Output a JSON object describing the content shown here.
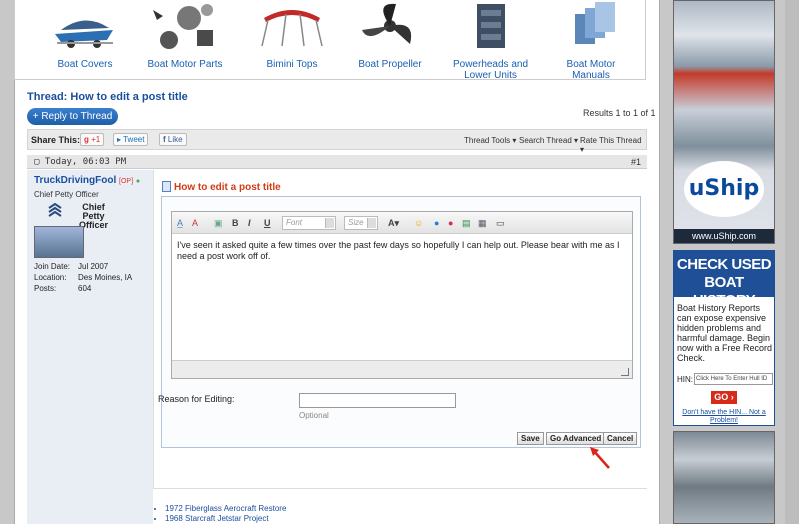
{
  "products": [
    {
      "label": "Boat Covers",
      "icon": "boat-cover-icon"
    },
    {
      "label": "Boat Motor Parts",
      "icon": "motor-parts-icon"
    },
    {
      "label": "Bimini Tops",
      "icon": "bimini-icon"
    },
    {
      "label": "Boat Propeller",
      "icon": "propeller-icon"
    },
    {
      "label": "Powerheads and Lower Units",
      "icon": "powerhead-icon"
    },
    {
      "label": "Boat Motor Manuals",
      "icon": "manuals-icon"
    }
  ],
  "thread": {
    "title_prefix": "Thread:",
    "title": "How to edit a post title",
    "reply_button": "Reply to Thread",
    "results": "Results 1 to 1 of 1"
  },
  "share": {
    "label": "Share This:",
    "gplus": "+1",
    "tweet": "Tweet",
    "like": "Like",
    "tools": [
      "Thread Tools",
      "Search Thread",
      "Rate This Thread"
    ]
  },
  "post": {
    "date": "Today, 06:03 PM",
    "number": "#1",
    "title": "How to edit a post title",
    "username": "TruckDrivingFool",
    "op_tag": "[OP]",
    "user_title": "Chief Petty Officer",
    "rank_label": "Chief Petty Officer",
    "stats": [
      {
        "label": "Join Date:",
        "value": "Jul 2007"
      },
      {
        "label": "Location:",
        "value": "Des Moines, IA"
      },
      {
        "label": "Posts:",
        "value": "604"
      }
    ]
  },
  "editor": {
    "font_placeholder": "Font",
    "size_placeholder": "Size",
    "content": "I've seen it asked quite a few times over the past few days so hopefully I can help out. Please bear with me as I need a post work off of.",
    "reason_label": "Reason for Editing:",
    "reason_value": "",
    "reason_hint": "Optional",
    "buttons": {
      "save": "Save",
      "advanced": "Go Advanced",
      "cancel": "Cancel"
    }
  },
  "related": [
    "1972 Fiberglass Aerocraft Restore",
    "1968 Starcraft Jetstar Project"
  ],
  "ads": {
    "uship_logo": "uShip",
    "uship_url": "www.uShip.com",
    "boat_history_title": "CHECK USED BOAT HISTORY",
    "boat_history_body": "Boat History Reports can expose expensive hidden problems and harmful damage. Begin now with a Free Record Check.",
    "hin_label": "HIN:",
    "hin_placeholder": "Click Here To Enter Hull ID",
    "go_label": "GO",
    "no_hin": "Don't have the HIN... Not a Problem!"
  },
  "colors": {
    "link": "#1a4e9e",
    "accent": "#d23b14",
    "ad_blue": "#1f4f97",
    "annotation": "#e0211a"
  }
}
